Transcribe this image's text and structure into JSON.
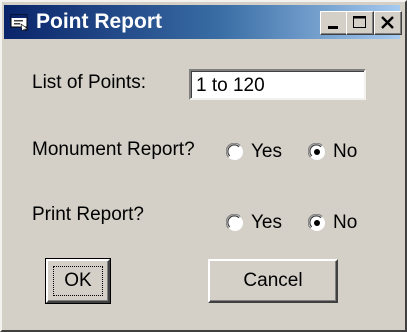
{
  "window": {
    "title": "Point Report",
    "minimize_glyph": "_",
    "maximize_glyph": "□",
    "close_glyph": "×"
  },
  "fields": {
    "list_of_points_label": "List of Points:",
    "list_of_points_value": "1 to 120"
  },
  "monument": {
    "label": "Monument Report?",
    "yes_label": "Yes",
    "no_label": "No",
    "selected": "No"
  },
  "print": {
    "label": "Print Report?",
    "yes_label": "Yes",
    "no_label": "No",
    "selected": "No"
  },
  "buttons": {
    "ok_label": "OK",
    "cancel_label": "Cancel"
  },
  "colors": {
    "title_gradient_start": "#0a246a",
    "title_gradient_end": "#a6caf0",
    "face": "#d4d0c8"
  },
  "icons": {
    "title": "app-icon",
    "minimize": "minimize-icon",
    "maximize": "maximize-icon",
    "close": "close-icon"
  }
}
